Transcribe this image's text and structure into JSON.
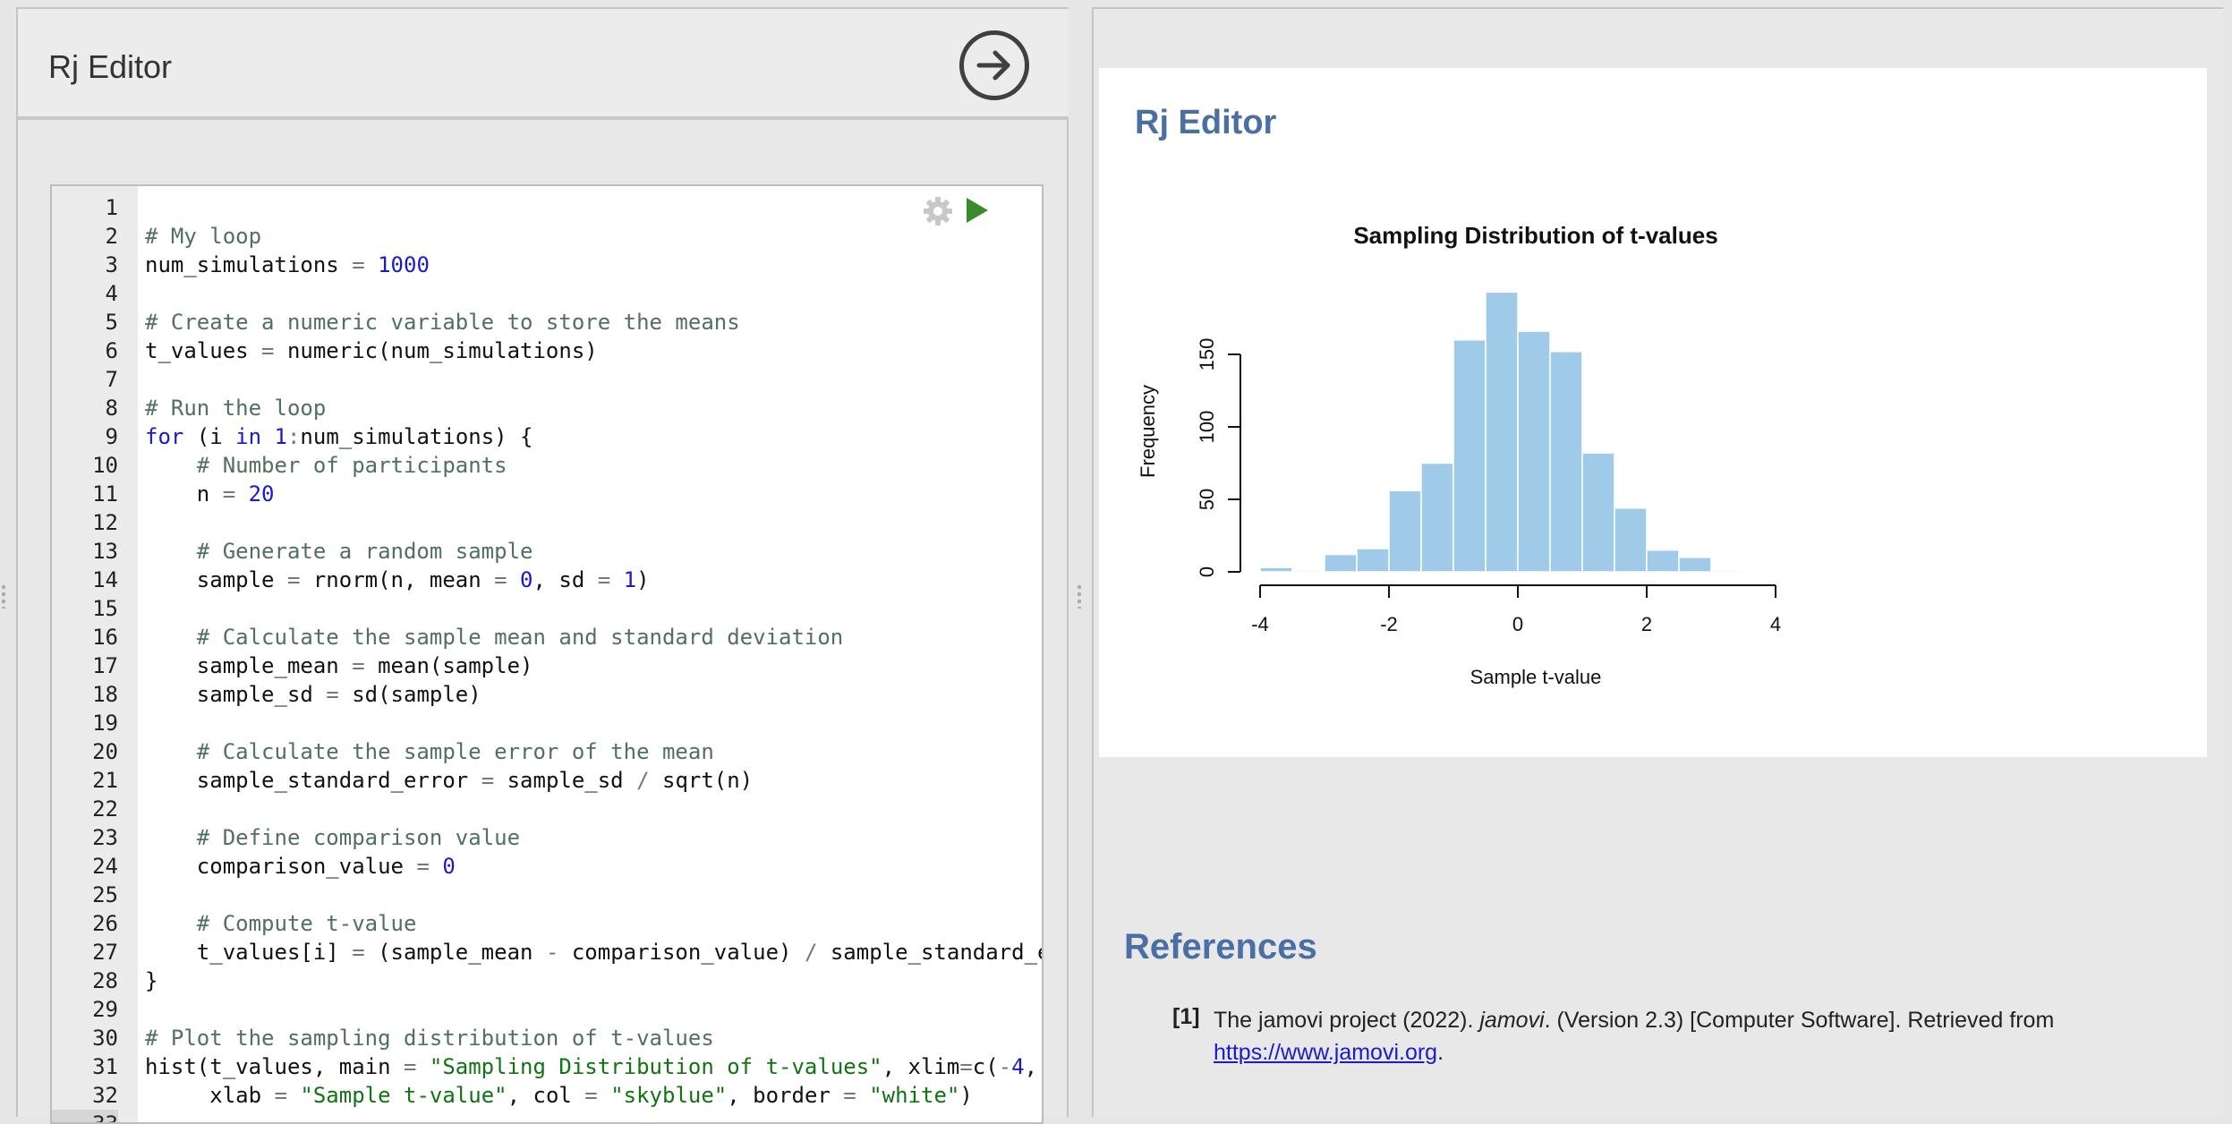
{
  "editor_panel": {
    "title": "Rj Editor",
    "run_icon": "arrow-circle-right-icon",
    "settings_icon": "gear-icon",
    "play_icon": "play-icon"
  },
  "code": {
    "lines": [
      [],
      [
        [
          "cm",
          "# My loop"
        ]
      ],
      [
        [
          "",
          "num_simulations "
        ],
        [
          "op",
          "="
        ],
        [
          "",
          ""
        ],
        [
          "nm",
          " 1000"
        ]
      ],
      [],
      [
        [
          "cm",
          "# Create a numeric variable to store the means"
        ]
      ],
      [
        [
          "",
          "t_values "
        ],
        [
          "op",
          "="
        ],
        [
          "",
          " numeric(num_simulations)"
        ]
      ],
      [],
      [
        [
          "cm",
          "# Run the loop"
        ]
      ],
      [
        [
          "kw",
          "for"
        ],
        [
          "",
          " (i "
        ],
        [
          "kw",
          "in"
        ],
        [
          "",
          " "
        ],
        [
          "nm",
          "1"
        ],
        [
          "op",
          ":"
        ],
        [
          "",
          "num_simulations) {"
        ]
      ],
      [
        [
          "",
          "    "
        ],
        [
          "cm",
          "# Number of participants"
        ]
      ],
      [
        [
          "",
          "    n "
        ],
        [
          "op",
          "="
        ],
        [
          "nm",
          " 20"
        ]
      ],
      [],
      [
        [
          "",
          "    "
        ],
        [
          "cm",
          "# Generate a random sample"
        ]
      ],
      [
        [
          "",
          "    sample "
        ],
        [
          "op",
          "="
        ],
        [
          "",
          " rnorm(n, mean "
        ],
        [
          "op",
          "="
        ],
        [
          "nm",
          " 0"
        ],
        [
          "",
          ", sd "
        ],
        [
          "op",
          "="
        ],
        [
          "nm",
          " 1"
        ],
        [
          "",
          ")"
        ]
      ],
      [],
      [
        [
          "",
          "    "
        ],
        [
          "cm",
          "# Calculate the sample mean and standard deviation"
        ]
      ],
      [
        [
          "",
          "    sample_mean "
        ],
        [
          "op",
          "="
        ],
        [
          "",
          " mean(sample)"
        ]
      ],
      [
        [
          "",
          "    sample_sd "
        ],
        [
          "op",
          "="
        ],
        [
          "",
          " sd(sample)"
        ]
      ],
      [],
      [
        [
          "",
          "    "
        ],
        [
          "cm",
          "# Calculate the sample error of the mean"
        ]
      ],
      [
        [
          "",
          "    sample_standard_error "
        ],
        [
          "op",
          "="
        ],
        [
          "",
          " sample_sd "
        ],
        [
          "op",
          "/"
        ],
        [
          "",
          " sqrt(n)"
        ]
      ],
      [],
      [
        [
          "",
          "    "
        ],
        [
          "cm",
          "# Define comparison value"
        ]
      ],
      [
        [
          "",
          "    comparison_value "
        ],
        [
          "op",
          "="
        ],
        [
          "nm",
          " 0"
        ]
      ],
      [],
      [
        [
          "",
          "    "
        ],
        [
          "cm",
          "# Compute t-value"
        ]
      ],
      [
        [
          "",
          "    t_values[i] "
        ],
        [
          "op",
          "="
        ],
        [
          "",
          " (sample_mean "
        ],
        [
          "op",
          "-"
        ],
        [
          "",
          " comparison_value) "
        ],
        [
          "op",
          "/"
        ],
        [
          "",
          " sample_standard_error"
        ]
      ],
      [
        [
          "",
          "}"
        ]
      ],
      [],
      [
        [
          "cm",
          "# Plot the sampling distribution of t-values"
        ]
      ],
      [
        [
          "",
          "hist(t_values, main "
        ],
        [
          "op",
          "="
        ],
        [
          "st",
          " \"Sampling Distribution of t-values\""
        ],
        [
          "",
          ", xlim"
        ],
        [
          "op",
          "="
        ],
        [
          "",
          "c("
        ],
        [
          "op",
          "-"
        ],
        [
          "nm",
          "4"
        ],
        [
          "",
          ", "
        ]
      ],
      [
        [
          "",
          "     xlab "
        ],
        [
          "op",
          "="
        ],
        [
          "st",
          " \"Sample t-value\""
        ],
        [
          "",
          ", col "
        ],
        [
          "op",
          "="
        ],
        [
          "st",
          " \"skyblue\""
        ],
        [
          "",
          ", border "
        ],
        [
          "op",
          "="
        ],
        [
          "st",
          " \"white\""
        ],
        [
          "",
          ")"
        ]
      ],
      []
    ]
  },
  "results": {
    "title": "Rj Editor"
  },
  "chart_data": {
    "type": "bar",
    "title": "Sampling Distribution of t-values",
    "xlabel": "Sample t-value",
    "ylabel": "Frequency",
    "xlim": [
      -4,
      4
    ],
    "ylim": [
      0,
      150
    ],
    "x_ticks": [
      "-4",
      "-2",
      "0",
      "2",
      "4"
    ],
    "y_ticks": [
      "0",
      "50",
      "100",
      "150"
    ],
    "bin_width": 0.5,
    "bin_starts": [
      -4.0,
      -3.5,
      -3.0,
      -2.5,
      -2.0,
      -1.5,
      -1.0,
      -0.5,
      0.0,
      0.5,
      1.0,
      1.5,
      2.0,
      2.5,
      3.0
    ],
    "values": [
      3,
      1,
      12,
      16,
      56,
      75,
      160,
      193,
      166,
      152,
      82,
      44,
      15,
      10,
      1
    ],
    "bar_color": "#9fcbe8",
    "border_color": "#ffffff",
    "grid": false
  },
  "references": {
    "title": "References",
    "items": [
      {
        "num": "[1]",
        "before": "The jamovi project (2022). ",
        "italic": "jamovi",
        "after": ". (Version 2.3) [Computer Software]. Retrieved from ",
        "link": "https://www.jamovi.org",
        "end": "."
      }
    ]
  }
}
